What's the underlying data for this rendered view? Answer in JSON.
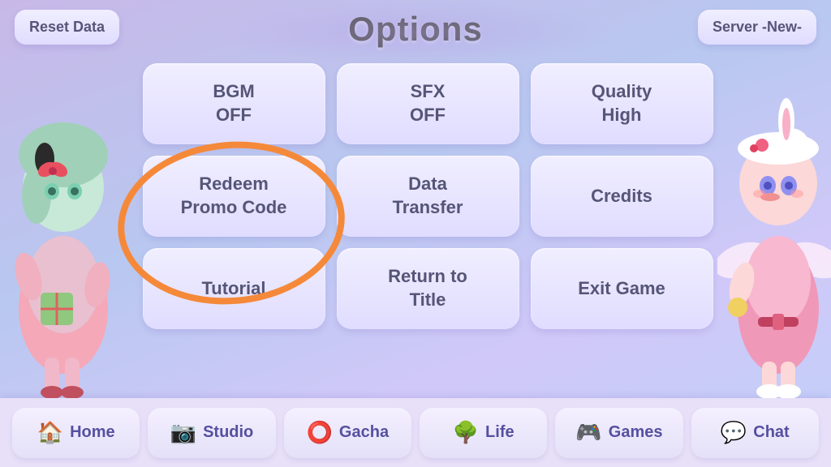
{
  "page": {
    "title": "Options",
    "background_color": "#c8b8f0"
  },
  "corner_buttons": {
    "reset": "Reset\nData",
    "server": "Server\n-New-"
  },
  "option_buttons": [
    {
      "id": "bgm",
      "label": "BGM\nOFF",
      "row": 1,
      "col": 1
    },
    {
      "id": "sfx",
      "label": "SFX\nOFF",
      "row": 1,
      "col": 2
    },
    {
      "id": "quality",
      "label": "Quality\nHigh",
      "row": 1,
      "col": 3
    },
    {
      "id": "redeem",
      "label": "Redeem\nPromo Code",
      "row": 2,
      "col": 1
    },
    {
      "id": "data-transfer",
      "label": "Data\nTransfer",
      "row": 2,
      "col": 2
    },
    {
      "id": "credits",
      "label": "Credits",
      "row": 2,
      "col": 3
    },
    {
      "id": "tutorial",
      "label": "Tutorial",
      "row": 3,
      "col": 1
    },
    {
      "id": "return-title",
      "label": "Return to\nTitle",
      "row": 3,
      "col": 2
    },
    {
      "id": "exit-game",
      "label": "Exit Game",
      "row": 3,
      "col": 3
    }
  ],
  "nav_items": [
    {
      "id": "home",
      "label": "Home",
      "icon": "🏠"
    },
    {
      "id": "studio",
      "label": "Studio",
      "icon": "📷"
    },
    {
      "id": "gacha",
      "label": "Gacha",
      "icon": "⭕"
    },
    {
      "id": "life",
      "label": "Life",
      "icon": "🌳"
    },
    {
      "id": "games",
      "label": "Games",
      "icon": "🎮"
    },
    {
      "id": "chat",
      "label": "Chat",
      "icon": "💬"
    }
  ]
}
